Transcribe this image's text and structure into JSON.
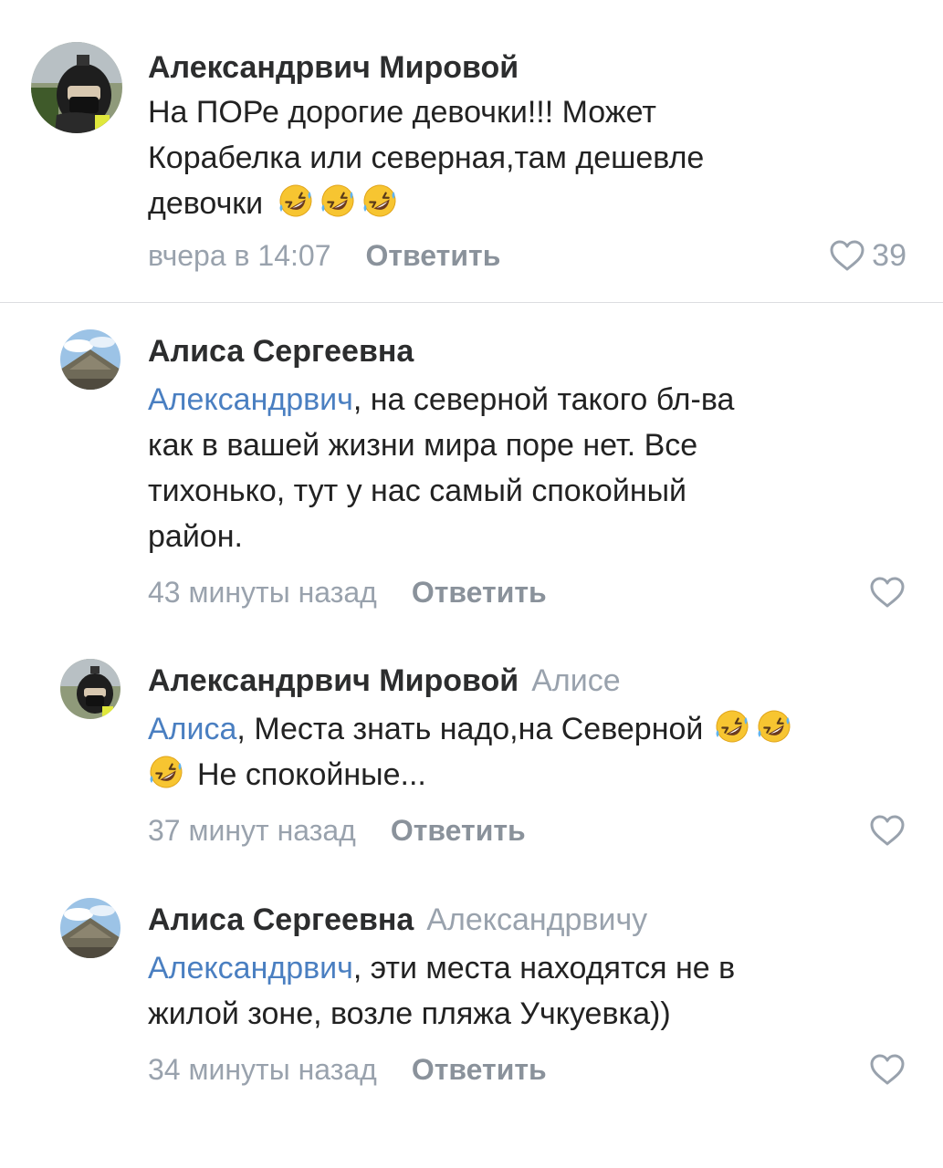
{
  "comments": [
    {
      "author": "Александрвич Мировой",
      "reply_to": "",
      "mention": "",
      "text_1": "На ПОРе дорогие девочки!!! Может",
      "text_2": "Корабелка или северная,там дешевле",
      "text_3": "девочки",
      "time": "вчера в 14:07",
      "reply_label": "Ответить",
      "likes": "39"
    },
    {
      "author": "Алиса Сергеевна",
      "reply_to": "",
      "mention": "Александрвич",
      "text_1": ", на северной  такого бл-ва",
      "text_2": "как в вашей жизни мира поре нет. Все",
      "text_3": "тихонько, тут у нас самый спокойный",
      "text_4": "район.",
      "time": "43 минуты назад",
      "reply_label": "Ответить"
    },
    {
      "author": "Александрвич Мировой",
      "reply_to": "Алисе",
      "mention": "Алиса",
      "text_1": ", Места знать надо,на Северной",
      "text_2": "Не спокойные...",
      "time": "37 минут назад",
      "reply_label": "Ответить"
    },
    {
      "author": "Алиса Сергеевна",
      "reply_to": "Александрвичу",
      "mention": "Александрвич",
      "text_1": ", эти места находятся не в",
      "text_2": "жилой зоне, возле пляжа Учкуевка))",
      "time": "34 минуты назад",
      "reply_label": "Ответить"
    }
  ],
  "icons": {
    "emoji": "rolling-on-floor-laughing-emoji",
    "like": "heart-outline-icon"
  },
  "colors": {
    "mention": "#4a7fc1",
    "meta": "#99a2ad",
    "author": "#2c2d2e"
  }
}
